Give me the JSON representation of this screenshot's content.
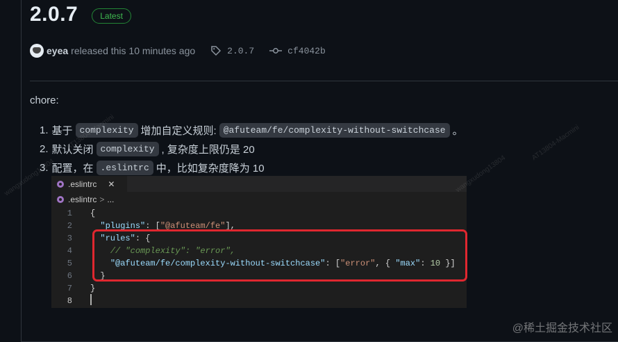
{
  "release": {
    "version": "2.0.7",
    "badge": "Latest",
    "author": "eyea",
    "released_text": "released this 10 minutes ago",
    "tag": "2.0.7",
    "commit": "cf4042b"
  },
  "notes": {
    "intro": "chore:",
    "items": [
      {
        "num": "1.",
        "pre": "基于",
        "code1": "complexity",
        "mid": "增加自定义规则:",
        "code2": "@afuteam/fe/complexity-without-switchcase",
        "post": "。"
      },
      {
        "num": "2.",
        "pre": "默认关闭",
        "code1": "complexity",
        "post": ", 复杂度上限仍是 20"
      },
      {
        "num": "3.",
        "pre": "配置，在",
        "code1": ".eslintrc",
        "post": "中，比如复杂度降为 10"
      }
    ]
  },
  "editor": {
    "tab_label": ".eslintrc",
    "close_glyph": "✕",
    "breadcrumb_file": ".eslintrc",
    "breadcrumb_sep": ">",
    "breadcrumb_more": "...",
    "line_numbers": [
      "1",
      "2",
      "3",
      "4",
      "5",
      "6",
      "7",
      "8"
    ]
  },
  "watermarks": {
    "user": "wangxudong13804",
    "machine": "AT13804-Macmini",
    "site": "@稀土掘金技术社区"
  },
  "colors": {
    "background": "#0d1117",
    "badge_green": "#3fb950",
    "highlight_red": "#e0272f",
    "eslint_purple": "#a074c4"
  }
}
